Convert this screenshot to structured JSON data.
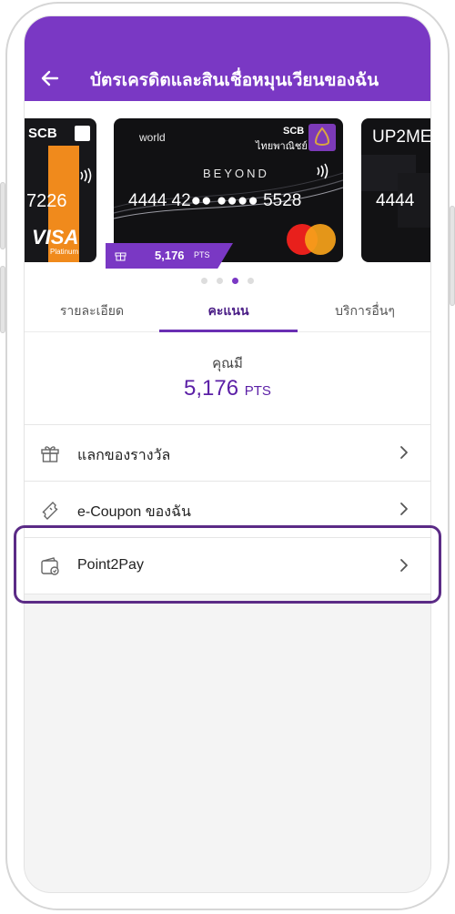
{
  "header": {
    "title": "บัตรเครดิตและสินเชื่อหมุนเวียนของฉัน"
  },
  "cards": {
    "left": {
      "brand": "SCB",
      "number_tail": "7226",
      "network": "VISA",
      "tier": "Platinum"
    },
    "main": {
      "tier": "world",
      "bank_name": "SCB",
      "bank_name_th": "ไทยพาณิชย์",
      "product": "BEYOND",
      "number": "4444 42●● ●●●● 5528",
      "points_badge": "5,176",
      "points_unit": "PTS"
    },
    "right": {
      "brand": "UP2ME",
      "number_head": "4444"
    }
  },
  "dots": {
    "count": 4,
    "active": 3
  },
  "tabs": [
    {
      "label": "รายละเอียด"
    },
    {
      "label": "คะแนน"
    },
    {
      "label": "บริการอื่นๆ"
    }
  ],
  "points": {
    "label": "คุณมี",
    "value": "5,176",
    "unit": "PTS"
  },
  "menu": [
    {
      "label": "แลกของรางวัล",
      "icon": "gift-icon"
    },
    {
      "label": "e-Coupon ของฉัน",
      "icon": "ticket-icon"
    },
    {
      "label": "Point2Pay",
      "icon": "wallet-icon"
    }
  ],
  "colors": {
    "brand_purple": "#7a38c4",
    "highlight_border": "#5b2b86"
  }
}
